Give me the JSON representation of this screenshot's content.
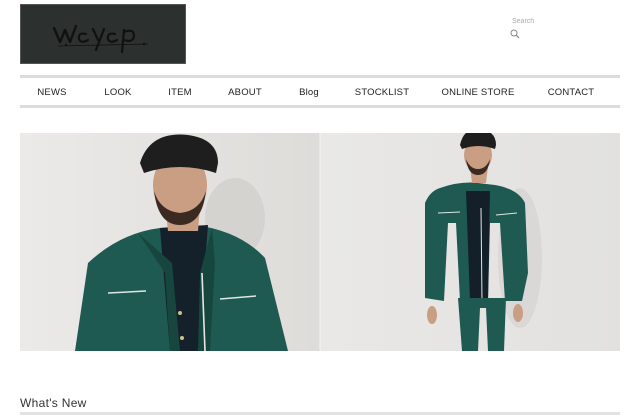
{
  "brand": {
    "logo_text": "weyep",
    "logo_bg": "#2c302f"
  },
  "search": {
    "placeholder": "Search",
    "icon": "search-icon"
  },
  "nav": {
    "items": [
      {
        "label": "NEWS"
      },
      {
        "label": "LOOK"
      },
      {
        "label": "ITEM"
      },
      {
        "label": "ABOUT"
      },
      {
        "label": "Blog"
      },
      {
        "label": "STOCKLIST"
      },
      {
        "label": "ONLINE STORE"
      },
      {
        "label": "CONTACT"
      }
    ]
  },
  "hero": {
    "image": "model-in-green-jacket-photo",
    "jacket_color": "#1f5a52"
  },
  "section": {
    "title": "What's New"
  }
}
